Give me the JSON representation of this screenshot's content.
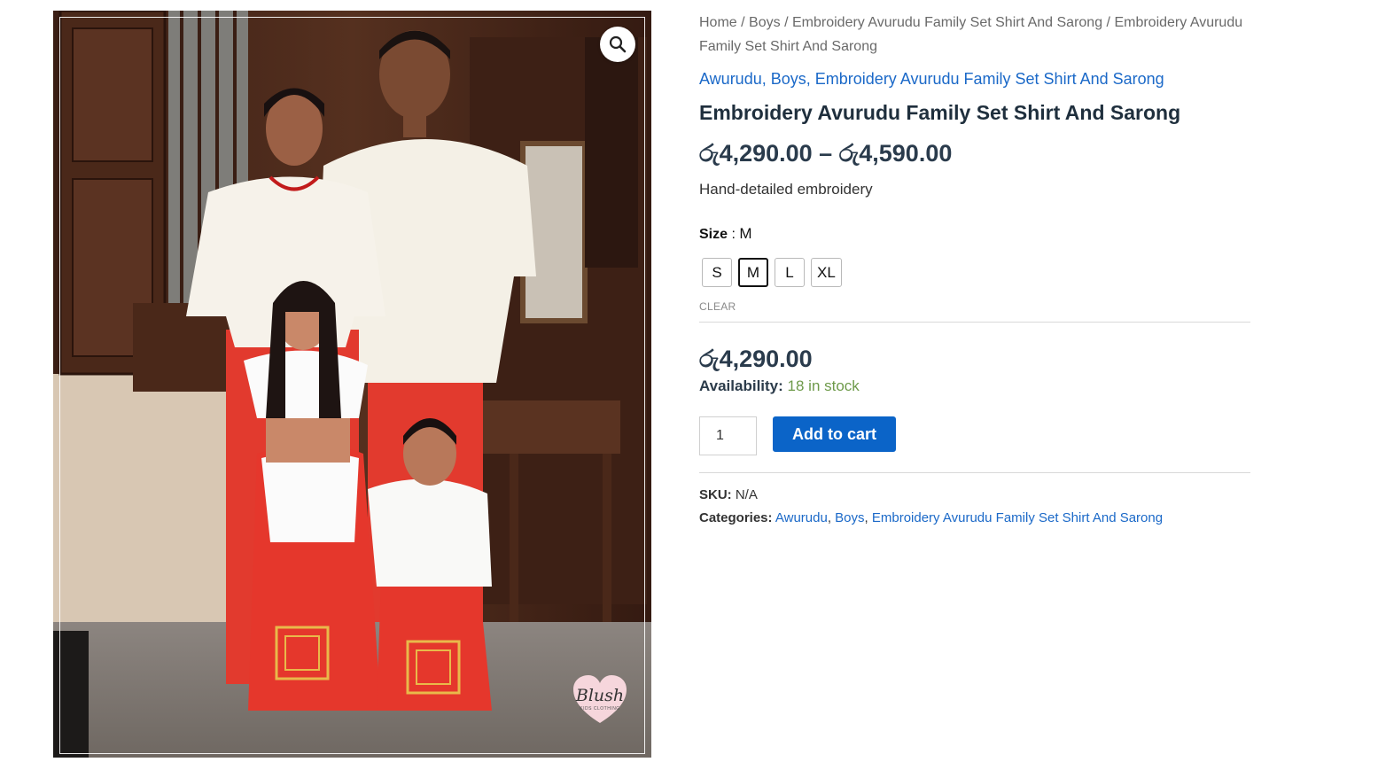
{
  "gallery": {
    "image_alt": "Family wearing embroidered Avurudu white shirts and red sarongs",
    "logo_text": "Blush",
    "logo_subtext": "KIDS CLOTHING",
    "zoom_icon": "magnifier-icon"
  },
  "breadcrumb": {
    "items": [
      "Home",
      "Boys",
      "Embroidery Avurudu Family Set Shirt And Sarong",
      "Embroidery Avurudu Family Set Shirt And Sarong"
    ],
    "separator": "/"
  },
  "categories_top": [
    "Awurudu",
    "Boys",
    "Embroidery Avurudu Family Set Shirt And Sarong"
  ],
  "product": {
    "title": "Embroidery Avurudu Family Set Shirt And Sarong",
    "price_range": "රු4,290.00 – රු4,590.00",
    "short_description": "Hand-detailed embroidery"
  },
  "variation": {
    "label": "Size",
    "selected": "M",
    "options": [
      "S",
      "M",
      "L",
      "XL"
    ],
    "clear_label": "CLEAR"
  },
  "variant_price": "රු4,290.00",
  "availability": {
    "label": "Availability:",
    "value": "18 in stock"
  },
  "cart": {
    "quantity": "1",
    "add_label": "Add to cart"
  },
  "meta": {
    "sku_label": "SKU:",
    "sku_value": "N/A",
    "categories_label": "Categories:",
    "categories": [
      "Awurudu",
      "Boys",
      "Embroidery Avurudu Family Set Shirt And Sarong"
    ]
  },
  "colors": {
    "link": "#1b69c8",
    "button": "#0b64c8",
    "stock": "#6e9a4a",
    "heading": "#1f2f3d"
  }
}
